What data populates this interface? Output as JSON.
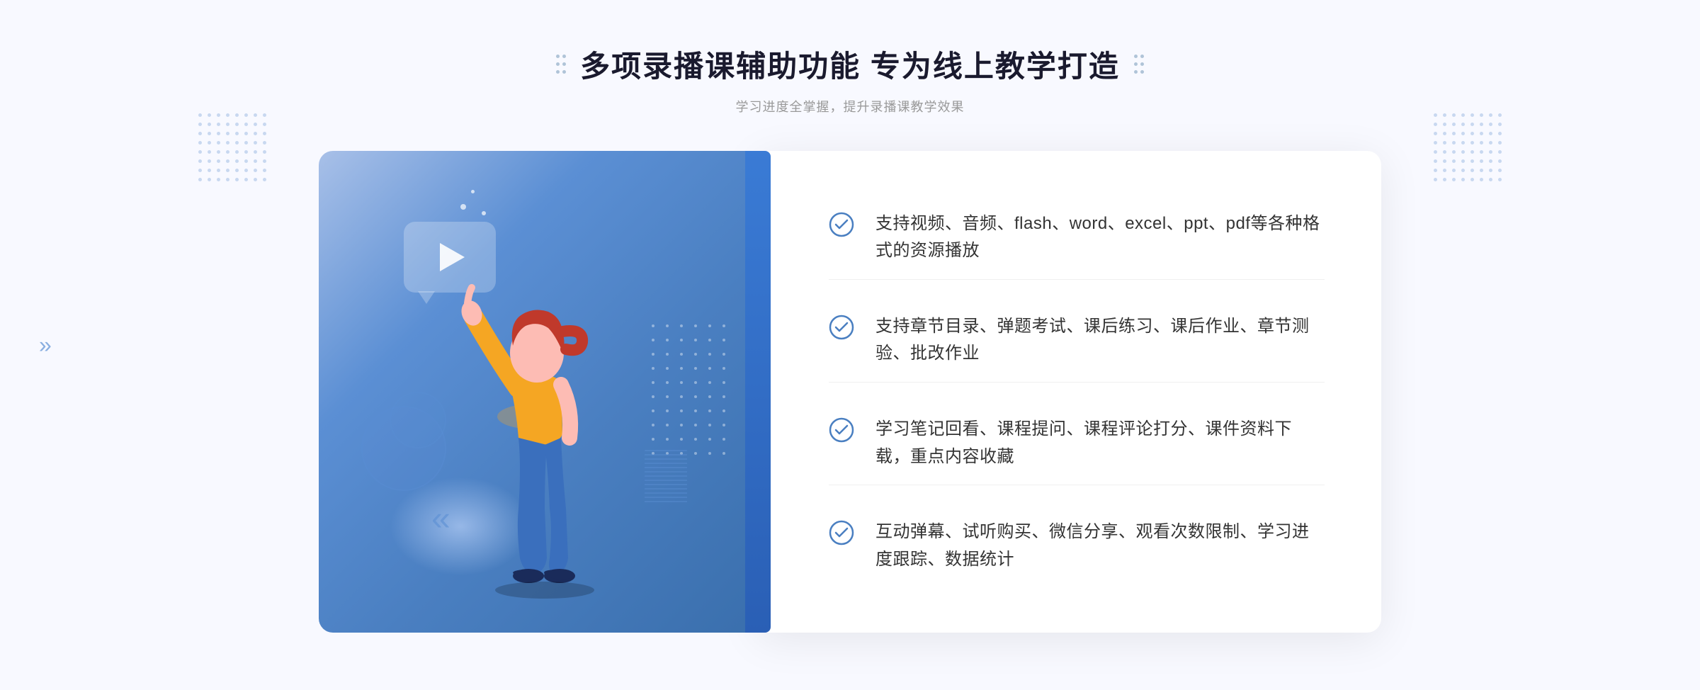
{
  "page": {
    "background_color": "#f8f9ff"
  },
  "header": {
    "title": "多项录播课辅助功能 专为线上教学打造",
    "subtitle": "学习进度全掌握，提升录播课教学效果"
  },
  "features": [
    {
      "id": 1,
      "text": "支持视频、音频、flash、word、excel、ppt、pdf等各种格式的资源播放"
    },
    {
      "id": 2,
      "text": "支持章节目录、弹题考试、课后练习、课后作业、章节测验、批改作业"
    },
    {
      "id": 3,
      "text": "学习笔记回看、课程提问、课程评论打分、课件资料下载，重点内容收藏"
    },
    {
      "id": 4,
      "text": "互动弹幕、试听购买、微信分享、观看次数限制、学习进度跟踪、数据统计"
    }
  ],
  "colors": {
    "primary_blue": "#4a7fc1",
    "light_blue": "#a8c0e8",
    "check_blue": "#4a7fc1",
    "title_dark": "#1a1a2e",
    "text_normal": "#333333",
    "text_sub": "#999999"
  },
  "icons": {
    "check_circle": "check-circle",
    "play": "play-icon",
    "chevron_right": "»"
  }
}
